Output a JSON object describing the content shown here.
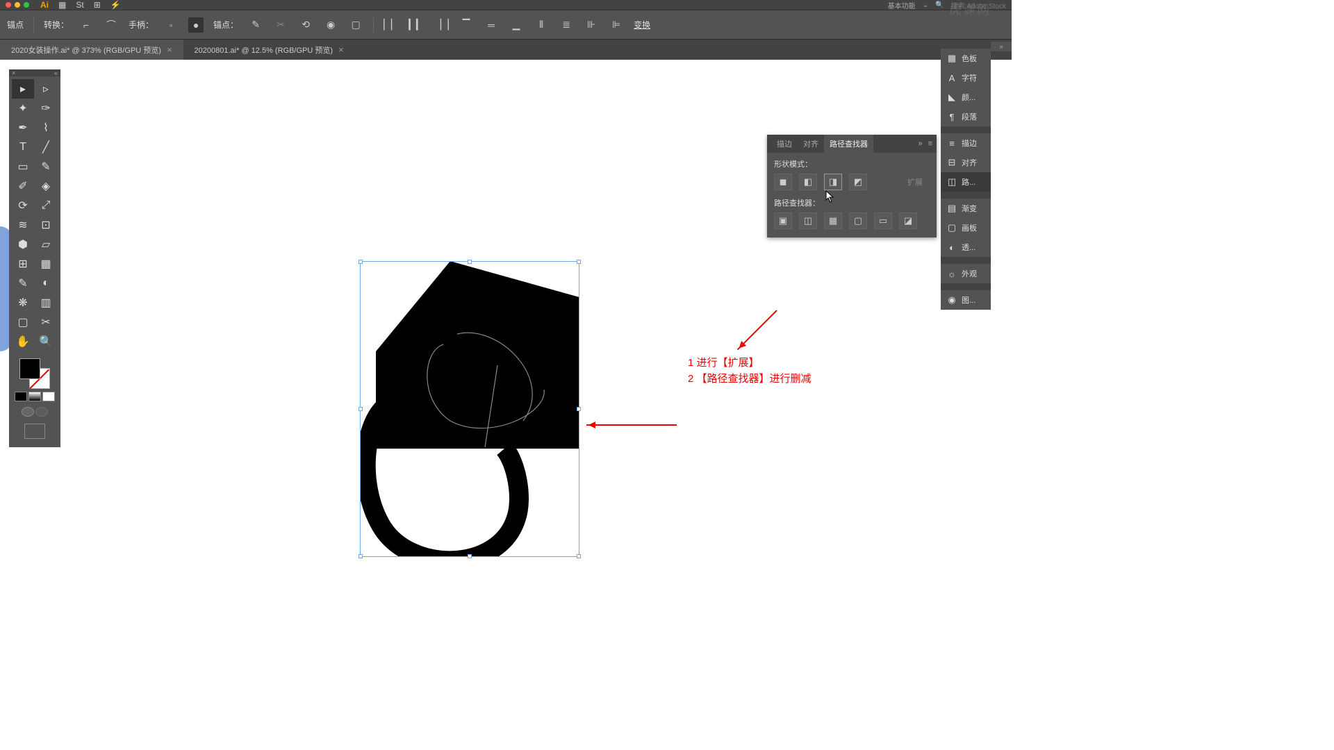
{
  "menubar": {
    "workspace": "基本功能",
    "search_placeholder": "搜索 Adobe Stock"
  },
  "controlbar": {
    "anchor": "锚点",
    "convert": "转换：",
    "handle": "手柄：",
    "anchor2": "锚点：",
    "transform": "变换"
  },
  "tabs": [
    {
      "name": "2020女装操作.ai* @ 373% (RGB/GPU 预览)",
      "active": true
    },
    {
      "name": "20200801.ai* @ 12.5% (RGB/GPU 预览)",
      "active": false
    }
  ],
  "pathfinder": {
    "tab_stroke": "描边",
    "tab_align": "对齐",
    "tab_pathfinder": "路径查找器",
    "shape_modes": "形状模式：",
    "expand": "扩展",
    "pathfinders": "路径查找器："
  },
  "dock": {
    "swatches": "色板",
    "character": "字符",
    "color": "颜...",
    "paragraph": "段落",
    "stroke": "描边",
    "align": "对齐",
    "pathfinder": "路...",
    "gradient": "渐变",
    "artboards": "画板",
    "transparency": "透...",
    "appearance": "外观",
    "graphic_styles": "图..."
  },
  "annotations": {
    "line1": "1  进行【扩展】",
    "line2": "2 【路径查找器】进行删减"
  },
  "watermark": "虎课网"
}
